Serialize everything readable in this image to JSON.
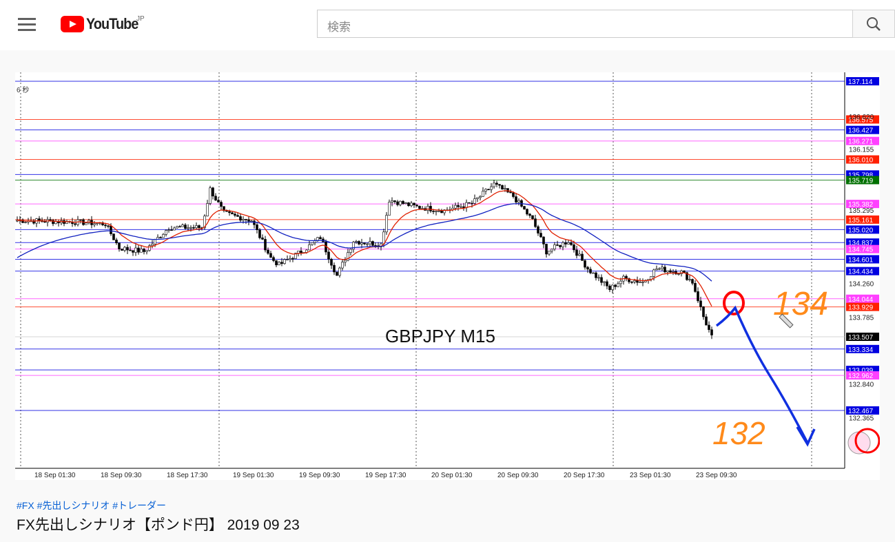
{
  "header": {
    "logo_text": "YouTube",
    "region": "JP",
    "search_placeholder": "検索"
  },
  "video": {
    "timeframe_label": "6 秒",
    "overlay_title": "GBPJPY M15",
    "annotations": {
      "upper_target": "134",
      "lower_target": "132"
    },
    "chart_data": {
      "type": "candlestick",
      "symbol": "GBPJPY",
      "timeframe": "M15",
      "ylim": [
        132.1,
        137.3
      ],
      "current_price": 133.507,
      "y_ticks": [
        "136.620",
        "136.155",
        "135.295",
        "134.260",
        "133.785",
        "132.840",
        "132.365"
      ],
      "x_labels": [
        "18 Sep 01:30",
        "18 Sep 09:30",
        "18 Sep 17:30",
        "19 Sep 01:30",
        "19 Sep 09:30",
        "19 Sep 17:30",
        "20 Sep 01:30",
        "20 Sep 09:30",
        "20 Sep 17:30",
        "23 Sep 01:30",
        "23 Sep 09:30"
      ],
      "levels": [
        {
          "price": "137.114",
          "color": "#0000e0"
        },
        {
          "price": "136.575",
          "color": "#ff2000"
        },
        {
          "price": "136.427",
          "color": "#0000e0"
        },
        {
          "price": "136.271",
          "color": "#ff40ff"
        },
        {
          "price": "136.010",
          "color": "#ff2000"
        },
        {
          "price": "135.798",
          "color": "#0000e0"
        },
        {
          "price": "135.719",
          "color": "#007000"
        },
        {
          "price": "135.382",
          "color": "#ff40ff"
        },
        {
          "price": "135.161",
          "color": "#ff2000"
        },
        {
          "price": "135.020",
          "color": "#0000e0"
        },
        {
          "price": "134.837",
          "color": "#0000e0"
        },
        {
          "price": "134.745",
          "color": "#ff40ff"
        },
        {
          "price": "134.601",
          "color": "#0000e0"
        },
        {
          "price": "134.434",
          "color": "#0000e0"
        },
        {
          "price": "134.044",
          "color": "#ff40ff"
        },
        {
          "price": "133.929",
          "color": "#ff2000"
        },
        {
          "price": "133.507",
          "color": "#000000"
        },
        {
          "price": "133.334",
          "color": "#0000e0"
        },
        {
          "price": "133.039",
          "color": "#0000e0"
        },
        {
          "price": "132.962",
          "color": "#ff40ff"
        },
        {
          "price": "132.467",
          "color": "#0000e0"
        }
      ],
      "price_path": [
        [
          0,
          135.15
        ],
        [
          20,
          135.13
        ],
        [
          32,
          135.1
        ],
        [
          37,
          134.76
        ],
        [
          46,
          134.71
        ],
        [
          55,
          135.05
        ],
        [
          67,
          135.05
        ],
        [
          70,
          135.59
        ],
        [
          75,
          135.25
        ],
        [
          85,
          135.15
        ],
        [
          92,
          134.62
        ],
        [
          95,
          134.52
        ],
        [
          105,
          134.76
        ],
        [
          110,
          134.91
        ],
        [
          116,
          134.37
        ],
        [
          122,
          134.86
        ],
        [
          132,
          134.81
        ],
        [
          135,
          135.44
        ],
        [
          145,
          135.34
        ],
        [
          155,
          135.29
        ],
        [
          165,
          135.39
        ],
        [
          173,
          135.66
        ],
        [
          180,
          135.49
        ],
        [
          187,
          135.15
        ],
        [
          192,
          134.71
        ],
        [
          200,
          134.86
        ],
        [
          207,
          134.47
        ],
        [
          215,
          134.18
        ],
        [
          220,
          134.33
        ],
        [
          227,
          134.28
        ],
        [
          232,
          134.47
        ],
        [
          241,
          134.42
        ],
        [
          245,
          134.28
        ],
        [
          249,
          133.79
        ],
        [
          252,
          133.5
        ]
      ],
      "series": [
        {
          "name": "fast MA",
          "color": "#e02000"
        },
        {
          "name": "slow MA",
          "color": "#1020c0"
        }
      ]
    }
  },
  "tags": "#FX #先出しシナリオ #トレーダー",
  "title": "FX先出しシナリオ【ポンド円】 2019 09 23"
}
